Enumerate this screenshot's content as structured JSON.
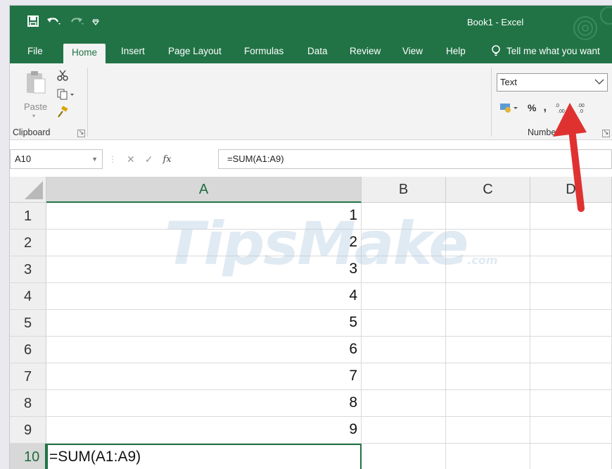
{
  "title_bar": {
    "book_title": "Book1  -  Excel"
  },
  "tabs": [
    "File",
    "Home",
    "Insert",
    "Page Layout",
    "Formulas",
    "Data",
    "Review",
    "View",
    "Help"
  ],
  "tell_me": "Tell me what you want",
  "ribbon": {
    "clipboard": {
      "paste_label": "Paste",
      "group_label": "Clipboard"
    },
    "number": {
      "format_value": "Text",
      "group_label": "Number",
      "percent": "%",
      "comma": ","
    }
  },
  "formula_bar": {
    "name_box": "A10",
    "fx": "fx",
    "formula": "=SUM(A1:A9)"
  },
  "sheet": {
    "columns": [
      "A",
      "B",
      "C",
      "D"
    ],
    "rows": [
      "1",
      "2",
      "3",
      "4",
      "5",
      "6",
      "7",
      "8",
      "9",
      "10"
    ],
    "a_values": [
      "1",
      "2",
      "3",
      "4",
      "5",
      "6",
      "7",
      "8",
      "9",
      "=SUM(A1:A9)"
    ],
    "active_cell": "A10"
  },
  "watermark": {
    "text": "TipsMake",
    "suffix": ".com"
  },
  "colors": {
    "excel_green": "#217346",
    "arrow": "#e03131"
  }
}
